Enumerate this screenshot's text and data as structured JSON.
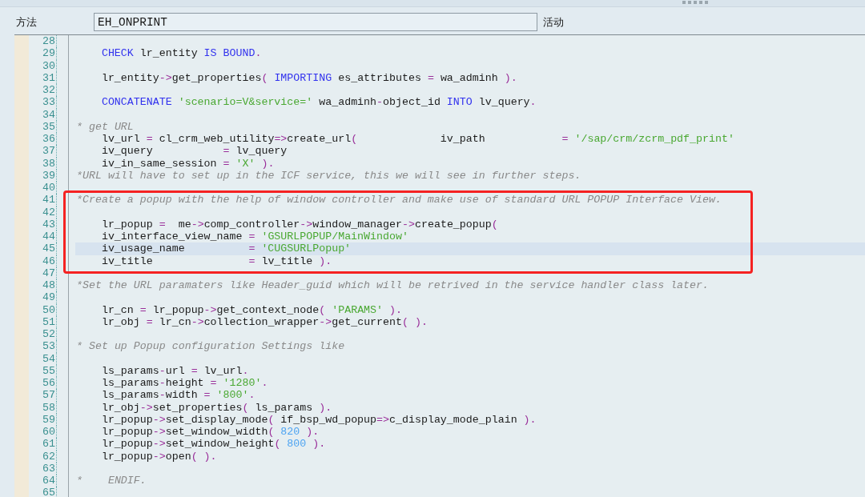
{
  "header": {
    "label": "方法",
    "field": {
      "value": "EH_ONPRINT"
    },
    "status": "活动"
  },
  "editor": {
    "blocks": [
      {
        "boxed": false,
        "lines": [
          {
            "number": "28",
            "kind": "blank",
            "selected": false
          },
          {
            "number": "29",
            "kind": "code",
            "selected": false,
            "text": "CHECK lr_entity IS BOUND."
          },
          {
            "number": "30",
            "kind": "blank",
            "selected": false
          },
          {
            "number": "31",
            "kind": "code",
            "selected": false,
            "text": "lr_entity->get_properties( IMPORTING es_attributes = wa_adminh )."
          },
          {
            "number": "32",
            "kind": "blank",
            "selected": false
          },
          {
            "number": "33",
            "kind": "code",
            "selected": false,
            "text": "CONCATENATE 'scenario=V&service=' wa_adminh-object_id INTO lv_query."
          },
          {
            "number": "34",
            "kind": "blank",
            "selected": false
          },
          {
            "number": "35",
            "kind": "comment",
            "selected": false,
            "text": "* get URL"
          },
          {
            "number": "36",
            "kind": "call",
            "selected": false,
            "text": "lv_url = cl_crm_web_utility=>create_url(",
            "name": "iv_path",
            "value": "= '/sap/crm/zcrm_pdf_print'"
          },
          {
            "number": "37",
            "kind": "param",
            "selected": false,
            "name": "iv_query",
            "value": "= lv_query"
          },
          {
            "number": "38",
            "kind": "param",
            "selected": false,
            "name": "iv_in_same_session",
            "value": "= 'X' )."
          },
          {
            "number": "39",
            "kind": "comment",
            "selected": false,
            "text": "*URL will have to set up in the ICF service, this we will see in further steps."
          },
          {
            "number": "40",
            "kind": "blank",
            "selected": false
          }
        ]
      },
      {
        "boxed": true,
        "lines": [
          {
            "number": "41",
            "kind": "comment",
            "selected": false,
            "text": "*Create a popup with the help of window controller and make use of standard URL POPUP Interface View."
          },
          {
            "number": "42",
            "kind": "blank",
            "selected": false
          },
          {
            "number": "43",
            "kind": "code",
            "selected": false,
            "text": "lr_popup =  me->comp_controller->window_manager->create_popup("
          },
          {
            "number": "44",
            "kind": "param",
            "selected": false,
            "name": "iv_interface_view_name",
            "value": "= 'GSURLPOPUP/MainWindow'"
          },
          {
            "number": "45",
            "kind": "param",
            "selected": true,
            "name": "iv_usage_name",
            "value": "= 'CUGSURLPopup'"
          },
          {
            "number": "46",
            "kind": "param",
            "selected": false,
            "name": "iv_title",
            "value": "= lv_title )."
          }
        ]
      },
      {
        "boxed": false,
        "lines": [
          {
            "number": "47",
            "kind": "blank",
            "selected": false
          },
          {
            "number": "48",
            "kind": "comment",
            "selected": false,
            "text": "*Set the URL paramaters like Header_guid which will be retrived in the service handler class later."
          },
          {
            "number": "49",
            "kind": "blank",
            "selected": false
          },
          {
            "number": "50",
            "kind": "code",
            "selected": false,
            "text": "lr_cn = lr_popup->get_context_node( 'PARAMS' )."
          },
          {
            "number": "51",
            "kind": "code",
            "selected": false,
            "text": "lr_obj = lr_cn->collection_wrapper->get_current( )."
          },
          {
            "number": "52",
            "kind": "blank",
            "selected": false
          },
          {
            "number": "53",
            "kind": "comment",
            "selected": false,
            "text": "* Set up Popup configuration Settings like"
          },
          {
            "number": "54",
            "kind": "blank",
            "selected": false
          },
          {
            "number": "55",
            "kind": "code",
            "selected": false,
            "text": "ls_params-url = lv_url."
          },
          {
            "number": "56",
            "kind": "code",
            "selected": false,
            "text": "ls_params-height = '1280'."
          },
          {
            "number": "57",
            "kind": "code",
            "selected": false,
            "text": "ls_params-width = '800'."
          },
          {
            "number": "58",
            "kind": "code",
            "selected": false,
            "text": "lr_obj->set_properties( ls_params )."
          },
          {
            "number": "59",
            "kind": "code",
            "selected": false,
            "text": "lr_popup->set_display_mode( if_bsp_wd_popup=>c_display_mode_plain )."
          },
          {
            "number": "60",
            "kind": "code",
            "selected": false,
            "text": "lr_popup->set_window_width( 820 )."
          },
          {
            "number": "61",
            "kind": "code",
            "selected": false,
            "text": "lr_popup->set_window_height( 800 )."
          },
          {
            "number": "62",
            "kind": "code",
            "selected": false,
            "text": "lr_popup->open( )."
          },
          {
            "number": "63",
            "kind": "blank",
            "selected": false
          },
          {
            "number": "64",
            "kind": "comment",
            "selected": false,
            "text": "*    ENDIF."
          },
          {
            "number": "65",
            "kind": "blank",
            "selected": false
          }
        ]
      }
    ]
  }
}
